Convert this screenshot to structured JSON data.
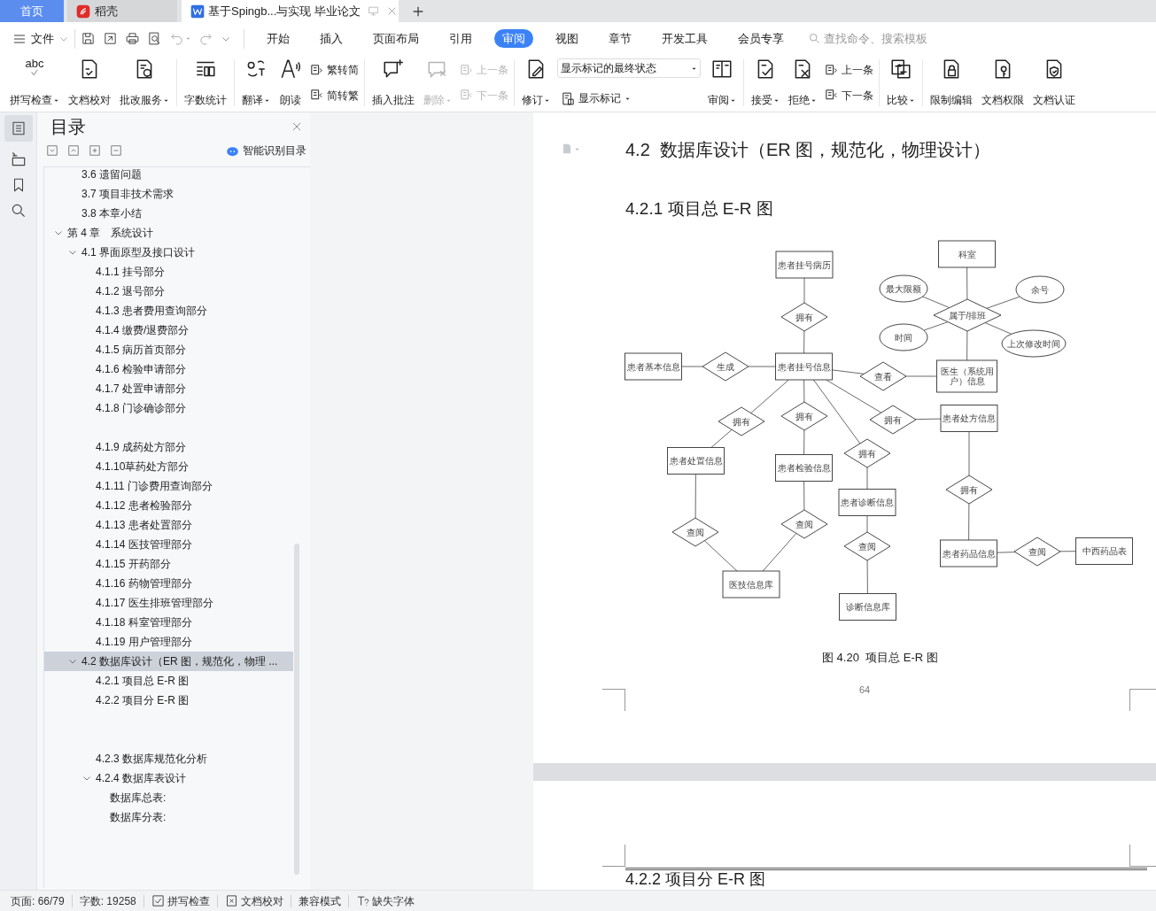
{
  "tabs": [
    {
      "label": "首页",
      "kind": "home",
      "selected": false
    },
    {
      "label": "稻壳",
      "kind": "app",
      "selected": false
    },
    {
      "label": "基于Spingb...与实现 毕业论文",
      "kind": "doc",
      "selected": true
    }
  ],
  "menu": {
    "file": "文件",
    "tabs": [
      {
        "label": "开始",
        "selected": false
      },
      {
        "label": "插入",
        "selected": false
      },
      {
        "label": "页面布局",
        "selected": false
      },
      {
        "label": "引用",
        "selected": false
      },
      {
        "label": "审阅",
        "selected": true
      },
      {
        "label": "视图",
        "selected": false
      },
      {
        "label": "章节",
        "selected": false
      },
      {
        "label": "开发工具",
        "selected": false
      },
      {
        "label": "会员专享",
        "selected": false
      }
    ],
    "search": {
      "placeholder": "查找命令、搜索模板"
    }
  },
  "ribbon": [
    {
      "items": [
        {
          "kind": "large",
          "label": "拼写检查",
          "icon_text": "abc",
          "dropdown": true,
          "disabled": false
        },
        {
          "kind": "large",
          "label": "文档校对",
          "dropdown": false,
          "disabled": false
        },
        {
          "kind": "large",
          "label": "批改服务",
          "dropdown": true,
          "disabled": false
        }
      ]
    },
    {
      "items": [
        {
          "kind": "large",
          "label": "字数统计",
          "dropdown": false,
          "disabled": false
        }
      ]
    },
    {
      "items": [
        {
          "kind": "large",
          "label": "翻译",
          "dropdown": true,
          "disabled": false
        },
        {
          "kind": "large",
          "label": "朗读",
          "dropdown": false,
          "disabled": false
        },
        {
          "kind": "stack",
          "items": [
            {
              "label": "繁转简",
              "disabled": false
            },
            {
              "label": "简转繁",
              "disabled": false
            }
          ]
        }
      ]
    },
    {
      "items": [
        {
          "kind": "large",
          "label": "插入批注",
          "dropdown": false,
          "disabled": false
        },
        {
          "kind": "large",
          "label": "删除",
          "dropdown": true,
          "disabled": true
        },
        {
          "kind": "stack",
          "items": [
            {
              "label": "上一条",
              "disabled": true
            },
            {
              "label": "下一条",
              "disabled": true
            }
          ]
        }
      ]
    },
    {
      "items": [
        {
          "kind": "large",
          "label": "修订",
          "dropdown": true,
          "disabled": false
        },
        {
          "kind": "select",
          "value": "显示标记的最终状态",
          "below": {
            "label": "显示标记",
            "dropdown": true
          }
        },
        {
          "kind": "large",
          "label": "审阅",
          "dropdown": true,
          "disabled": false
        }
      ]
    },
    {
      "items": [
        {
          "kind": "large",
          "label": "接受",
          "dropdown": true,
          "disabled": false
        },
        {
          "kind": "large",
          "label": "拒绝",
          "dropdown": true,
          "disabled": false
        },
        {
          "kind": "stack",
          "items": [
            {
              "label": "上一条",
              "disabled": false
            },
            {
              "label": "下一条",
              "disabled": false
            }
          ]
        }
      ]
    },
    {
      "items": [
        {
          "kind": "large",
          "label": "比较",
          "dropdown": true,
          "disabled": false
        }
      ]
    },
    {
      "items": [
        {
          "kind": "large",
          "label": "限制编辑",
          "dropdown": false,
          "disabled": false
        },
        {
          "kind": "large",
          "label": "文档权限",
          "dropdown": false,
          "disabled": false
        },
        {
          "kind": "large",
          "label": "文档认证",
          "dropdown": false,
          "disabled": false
        }
      ]
    }
  ],
  "panel": {
    "title": "目录",
    "smart_button": "智能识别目录",
    "continued_items": [
      {
        "label": "3.6 遗留问题"
      },
      {
        "label": "3.7 项目非技术需求"
      },
      {
        "label": "3.8 本章小结"
      }
    ],
    "items": [
      {
        "label": "第 4 章　系统设计",
        "expanded": true,
        "selected": false,
        "children": [
          {
            "label": "4.1  界面原型及接口设计",
            "expanded": true,
            "selected": false,
            "children": [
              {
                "label": "4.1.1  挂号部分"
              },
              {
                "label": "4.1.2  退号部分"
              },
              {
                "label": "4.1.3  患者费用查询部分"
              },
              {
                "label": "4.1.4  缴费/退费部分"
              },
              {
                "label": "4.1.5  病历首页部分"
              },
              {
                "label": "4.1.6  检验申请部分"
              },
              {
                "label": "4.1.7  处置申请部分"
              },
              {
                "label": "4.1.8  门诊确诊部分"
              },
              {
                "kind": "blank"
              },
              {
                "label": "4.1.9  成药处方部分"
              },
              {
                "label": "4.1.10草药处方部分"
              },
              {
                "label": "4.1.11 门诊费用查询部分"
              },
              {
                "label": "4.1.12 患者检验部分"
              },
              {
                "label": "4.1.13 患者处置部分"
              },
              {
                "label": "4.1.14 医技管理部分"
              },
              {
                "label": "4.1.15 开药部分"
              },
              {
                "label": "4.1.16 药物管理部分"
              },
              {
                "label": "4.1.17 医生排班管理部分"
              },
              {
                "label": "4.1.18 科室管理部分"
              },
              {
                "label": "4.1.19 用户管理部分"
              }
            ]
          },
          {
            "label": "4.2  数据库设计（ER 图，规范化，物理 ...",
            "expanded": true,
            "selected": true,
            "children": [
              {
                "label": "4.2.1 项目总 E-R 图"
              },
              {
                "label": "4.2.2 项目分 E-R 图"
              },
              {
                "kind": "blank"
              },
              {
                "kind": "blank"
              },
              {
                "label": "4.2.3 数据库规范化分析"
              },
              {
                "label": "4.2.4 数据库表设计",
                "expanded": true,
                "selected": false,
                "children": [
                  {
                    "label": "数据库总表:"
                  },
                  {
                    "label": "数据库分表:"
                  }
                ]
              }
            ]
          }
        ]
      }
    ]
  },
  "document": {
    "heading": "4.2  数据库设计（ER 图，规范化，物理设计）",
    "subheading": "4.2.1 项目总 E-R 图",
    "er_diagram": {
      "nodes": [
        {
          "kind": "entity",
          "label": "患者挂号病历"
        },
        {
          "kind": "entity",
          "label": "科室"
        },
        {
          "kind": "attribute",
          "label": "最大限额"
        },
        {
          "kind": "attribute",
          "label": "余号"
        },
        {
          "kind": "relationship",
          "label": "拥有"
        },
        {
          "kind": "relationship",
          "label": "属于/排班"
        },
        {
          "kind": "attribute",
          "label": "时间"
        },
        {
          "kind": "attribute",
          "label": "上次修改时间"
        },
        {
          "kind": "entity",
          "label": "患者基本信息"
        },
        {
          "kind": "relationship",
          "label": "生成"
        },
        {
          "kind": "entity",
          "label": "患者挂号信息"
        },
        {
          "kind": "relationship",
          "label": "查看"
        },
        {
          "kind": "entity",
          "label": "医生（系统用户）信息"
        },
        {
          "kind": "relationship",
          "label": "拥有"
        },
        {
          "kind": "relationship",
          "label": "拥有"
        },
        {
          "kind": "relationship",
          "label": "拥有"
        },
        {
          "kind": "entity",
          "label": "患者处方信息"
        },
        {
          "kind": "entity",
          "label": "患者处置信息"
        },
        {
          "kind": "entity",
          "label": "患者检验信息"
        },
        {
          "kind": "relationship",
          "label": "拥有"
        },
        {
          "kind": "entity",
          "label": "患者诊断信息"
        },
        {
          "kind": "relationship",
          "label": "拥有"
        },
        {
          "kind": "relationship",
          "label": "查阅"
        },
        {
          "kind": "relationship",
          "label": "查阅"
        },
        {
          "kind": "relationship",
          "label": "查阅"
        },
        {
          "kind": "entity",
          "label": "患者药品信息"
        },
        {
          "kind": "relationship",
          "label": "查阅"
        },
        {
          "kind": "entity",
          "label": "中西药品表"
        },
        {
          "kind": "entity",
          "label": "医技信息库"
        },
        {
          "kind": "entity",
          "label": "诊断信息库"
        }
      ]
    },
    "caption": "图 4.20  项目总 E-R 图",
    "page_number": "64",
    "next_heading": "4.2.2 项目分 E-R 图"
  },
  "status_bar": [
    {
      "kind": "text",
      "label": "页面: 66/79"
    },
    {
      "kind": "text",
      "label": "字数: 19258"
    },
    {
      "kind": "spell",
      "label": "拼写检查"
    },
    {
      "kind": "proof",
      "label": "文档校对"
    },
    {
      "kind": "text",
      "label": "兼容模式"
    },
    {
      "kind": "font",
      "label": "缺失字体"
    }
  ]
}
